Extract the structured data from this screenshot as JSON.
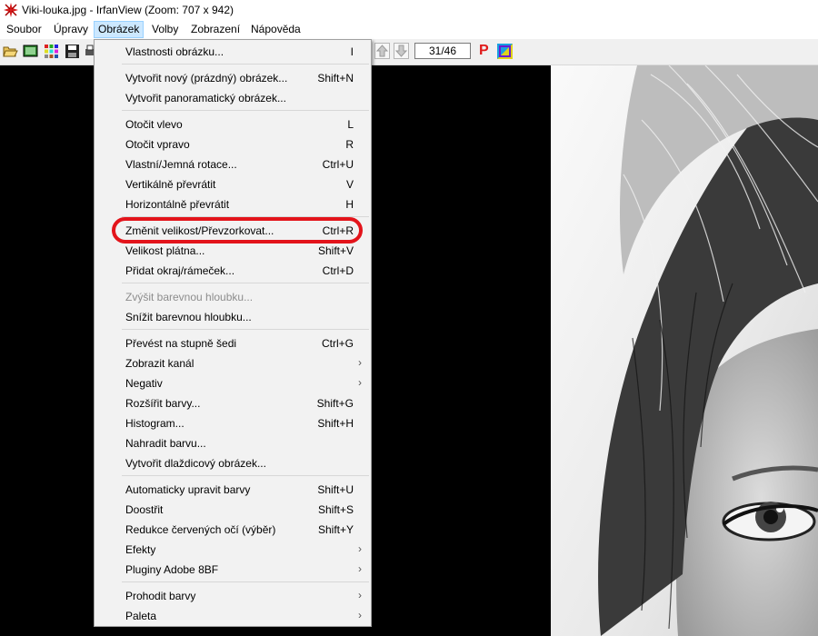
{
  "window": {
    "title": "Viki-louka.jpg - IrfanView (Zoom: 707 x 942)"
  },
  "menubar": {
    "items": [
      {
        "label": "Soubor"
      },
      {
        "label": "Úpravy"
      },
      {
        "label": "Obrázek"
      },
      {
        "label": "Volby"
      },
      {
        "label": "Zobrazení"
      },
      {
        "label": "Nápověda"
      }
    ]
  },
  "toolbar": {
    "page_counter": "31/46",
    "p_label": "P"
  },
  "menu": {
    "items": [
      {
        "label": "Vlastnosti obrázku...",
        "shortcut": "I"
      },
      {
        "label": "Vytvořit nový (prázdný) obrázek...",
        "shortcut": "Shift+N"
      },
      {
        "label": "Vytvořit panoramatický obrázek...",
        "shortcut": ""
      },
      {
        "label": "Otočit vlevo",
        "shortcut": "L"
      },
      {
        "label": "Otočit vpravo",
        "shortcut": "R"
      },
      {
        "label": "Vlastní/Jemná rotace...",
        "shortcut": "Ctrl+U"
      },
      {
        "label": "Vertikálně převrátit",
        "shortcut": "V"
      },
      {
        "label": "Horizontálně převrátit",
        "shortcut": "H"
      },
      {
        "label": "Změnit velikost/Převzorkovat...",
        "shortcut": "Ctrl+R"
      },
      {
        "label": "Velikost plátna...",
        "shortcut": "Shift+V"
      },
      {
        "label": "Přidat okraj/rámeček...",
        "shortcut": "Ctrl+D"
      },
      {
        "label": "Zvýšit barevnou hloubku...",
        "shortcut": ""
      },
      {
        "label": "Snížit barevnou hloubku...",
        "shortcut": ""
      },
      {
        "label": "Převést na stupně šedi",
        "shortcut": "Ctrl+G"
      },
      {
        "label": "Zobrazit kanál",
        "shortcut": ""
      },
      {
        "label": "Negativ",
        "shortcut": ""
      },
      {
        "label": "Rozšířit barvy...",
        "shortcut": "Shift+G"
      },
      {
        "label": "Histogram...",
        "shortcut": "Shift+H"
      },
      {
        "label": "Nahradit barvu...",
        "shortcut": ""
      },
      {
        "label": "Vytvořit dlaždicový obrázek...",
        "shortcut": ""
      },
      {
        "label": "Automaticky upravit barvy",
        "shortcut": "Shift+U"
      },
      {
        "label": "Doostřit",
        "shortcut": "Shift+S"
      },
      {
        "label": "Redukce červených očí (výběr)",
        "shortcut": "Shift+Y"
      },
      {
        "label": "Efekty",
        "shortcut": ""
      },
      {
        "label": "Pluginy Adobe 8BF",
        "shortcut": ""
      },
      {
        "label": "Prohodit barvy",
        "shortcut": ""
      },
      {
        "label": "Paleta",
        "shortcut": ""
      }
    ],
    "submenu_arrow": "›"
  },
  "colors": {
    "highlight_ring": "#e3141b",
    "menu_bg": "#f2f2f2",
    "active_menu": "#cce8ff"
  }
}
